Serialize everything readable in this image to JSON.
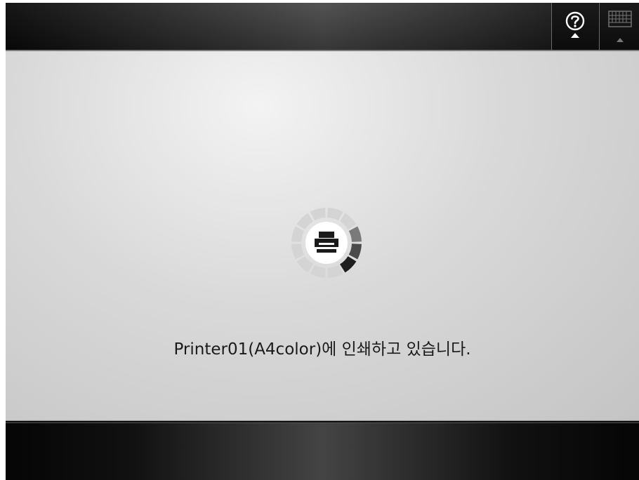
{
  "toolbar": {
    "help_icon": "help-question-icon",
    "keyboard_icon": "keyboard-icon"
  },
  "status": {
    "message": "Printer01(A4color)에 인쇄하고 있습니다."
  },
  "spinner": {
    "icon": "printer-icon",
    "segments_active": 3
  },
  "colors": {
    "spinner_active": "#1f1f1f",
    "spinner_inactive": "#d4d4d4"
  }
}
